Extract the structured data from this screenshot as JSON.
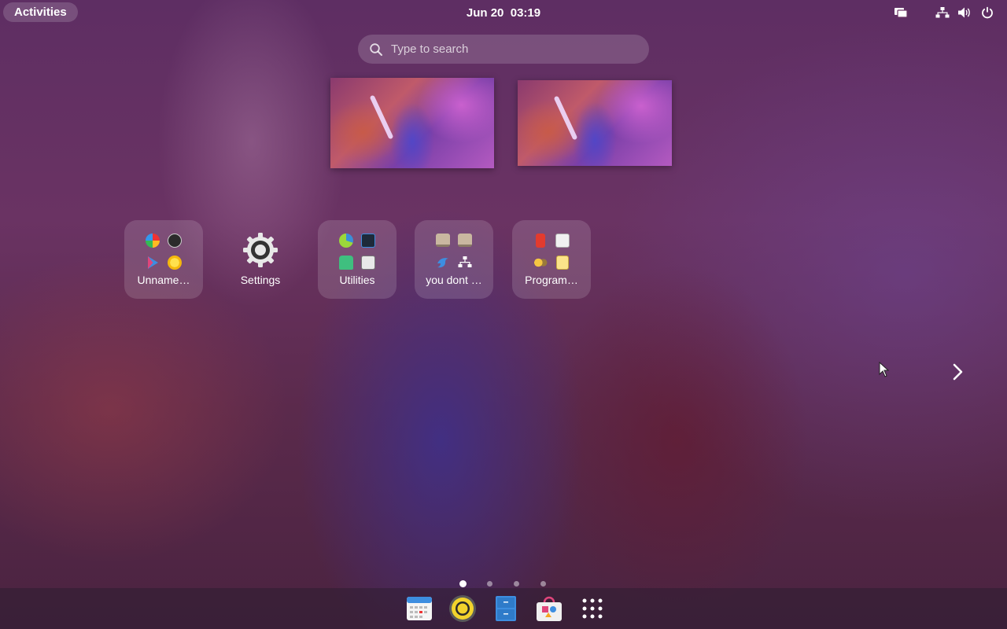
{
  "topbar": {
    "activities_label": "Activities",
    "date": "Jun 20",
    "time": "03:19",
    "tray_icons": [
      "display-icon",
      "network-icon",
      "volume-icon",
      "power-icon"
    ]
  },
  "search": {
    "placeholder": "Type to search"
  },
  "workspaces": [
    "workspace-1",
    "workspace-2"
  ],
  "apps": [
    {
      "label": "Unname…",
      "type": "folder",
      "icons": [
        "color-wheel-icon",
        "clock-icon",
        "play-icon",
        "weather-icon"
      ]
    },
    {
      "label": "Settings",
      "type": "app",
      "icon": "gear-icon"
    },
    {
      "label": "Utilities",
      "type": "folder",
      "icons": [
        "disk-usage-icon",
        "screenshot-icon",
        "android-icon",
        "document-viewer-icon"
      ]
    },
    {
      "label": "you dont …",
      "type": "folder",
      "icons": [
        "terminal-icon",
        "terminal-icon",
        "bird-icon",
        "network-icon"
      ]
    },
    {
      "label": "Program…",
      "type": "folder",
      "icons": [
        "office-icon",
        "calculator-icon",
        "photo-icon",
        "notes-icon"
      ]
    }
  ],
  "pagination": {
    "pages": 4,
    "current": 1
  },
  "dock": [
    "calendar-icon",
    "rhythmbox-icon",
    "file-cabinet-icon",
    "software-store-icon",
    "app-grid-icon"
  ],
  "colors": {
    "accent_blue": "#3d8ee0",
    "rhythmbox_yellow": "#f2d32c"
  }
}
